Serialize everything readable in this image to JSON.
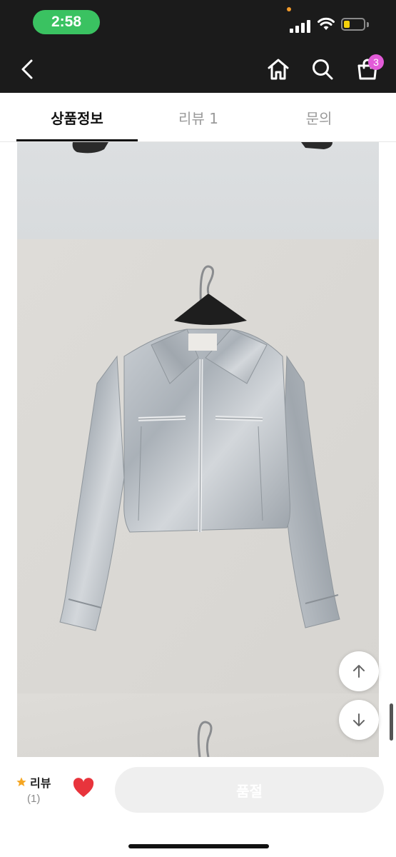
{
  "status_bar": {
    "time": "2:58"
  },
  "header": {
    "cart_count": "3"
  },
  "tabs": [
    {
      "label": "상품정보",
      "active": true
    },
    {
      "label": "리뷰 1",
      "active": false
    },
    {
      "label": "문의",
      "active": false
    }
  ],
  "bottom": {
    "review_label": "리뷰",
    "review_count": "(1)",
    "buy_label": "품절"
  },
  "colors": {
    "header_bg": "#1b1b1b",
    "time_pill": "#3ac261",
    "cart_badge": "#e25bd8",
    "heart": "#e8343c",
    "star": "#f5a623",
    "buy_disabled": "#efefef"
  },
  "icons": [
    "back-arrow-icon",
    "home-icon",
    "search-icon",
    "cart-icon",
    "star-icon",
    "heart-icon",
    "arrow-up-icon",
    "arrow-down-icon"
  ]
}
